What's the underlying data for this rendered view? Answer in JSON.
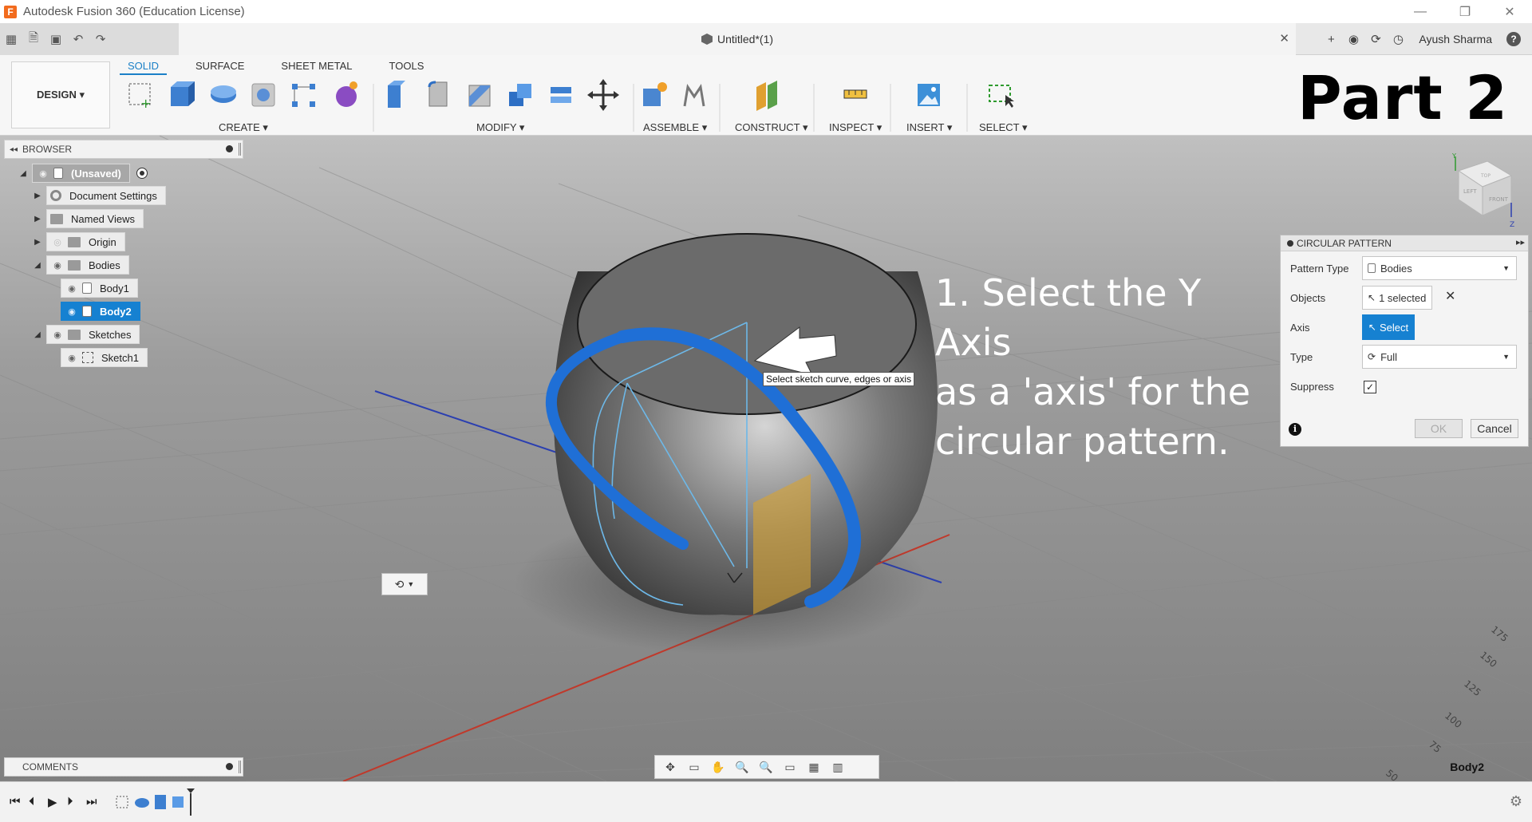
{
  "window": {
    "title": "Autodesk Fusion 360 (Education License)",
    "logo_letter": "F",
    "minimize": "—",
    "restore": "❐",
    "close": "✕"
  },
  "quick_access": {
    "document_title": "Untitled*(1)",
    "doc_close": "✕",
    "user_name": "Ayush Sharma",
    "help": "?"
  },
  "toolbar": {
    "workspace_label": "DESIGN ▾",
    "tabs": [
      "SOLID",
      "SURFACE",
      "SHEET METAL",
      "TOOLS"
    ],
    "groups": [
      "CREATE ▾",
      "MODIFY ▾",
      "ASSEMBLE ▾",
      "CONSTRUCT ▾",
      "INSPECT ▾",
      "INSERT ▾",
      "SELECT ▾"
    ],
    "overlay_title": "Part 2"
  },
  "browser": {
    "header": "BROWSER",
    "items": [
      {
        "label": "(Unsaved)"
      },
      {
        "label": "Document Settings"
      },
      {
        "label": "Named Views"
      },
      {
        "label": "Origin"
      },
      {
        "label": "Bodies"
      },
      {
        "label": "Body1"
      },
      {
        "label": "Body2",
        "selected": true
      },
      {
        "label": "Sketches"
      },
      {
        "label": "Sketch1"
      }
    ]
  },
  "comments": {
    "header": "COMMENTS"
  },
  "dialog": {
    "title": "CIRCULAR PATTERN",
    "pattern_type_label": "Pattern Type",
    "pattern_type_value": "Bodies",
    "objects_label": "Objects",
    "objects_value": "1 selected",
    "axis_label": "Axis",
    "axis_button": "Select",
    "type_label": "Type",
    "type_value": "Full",
    "suppress_label": "Suppress",
    "suppress_checked": true,
    "ok_label": "OK",
    "cancel_label": "Cancel",
    "info": "i"
  },
  "annotation": {
    "instruction_lines": [
      "1. Select the Y Axis",
      "as a 'axis' for the",
      "circular pattern."
    ],
    "tooltip": "Select sketch curve, edges or axis"
  },
  "viewport": {
    "selection_name": "Body2",
    "ruler_ticks": [
      "175",
      "150",
      "125",
      "100",
      "75",
      "50"
    ],
    "viewcube_labels": [
      "LEFT",
      "FRONT",
      "TOP"
    ],
    "axis_labels": [
      "Y",
      "Z"
    ],
    "colors": {
      "selection_blue": "#1f6fd6",
      "sketch_line": "#6db8e8",
      "axis_red": "#c0392b",
      "axis_blue": "#2b3fb0",
      "plane_orange": "#d8a430"
    }
  },
  "icons": {
    "grid": "▦",
    "file": "🗎",
    "save": "▣",
    "undo": "↶",
    "redo": "↷",
    "plus": "+",
    "refresh": "⟳",
    "clock": "◷",
    "bell": "◉",
    "pan": "✥",
    "orbit": "⟲",
    "hand": "✋",
    "zoom": "🔍",
    "display": "▭",
    "grid_view": "▦",
    "layout": "▥",
    "first": "⏮",
    "prev": "⏴",
    "play": "▶",
    "next": "⏵",
    "last": "⏭",
    "settings": "⚙"
  }
}
